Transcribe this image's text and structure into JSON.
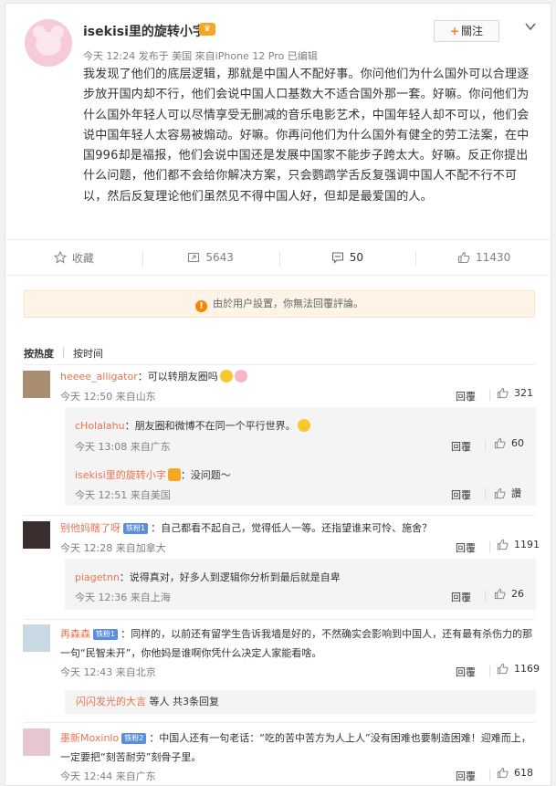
{
  "post": {
    "author": "isekisi里的旋转小字",
    "meta": "今天 12:24 发布于 美国 來自iPhone 12 Pro  已编辑",
    "follow_label": "關注",
    "text": "我发现了他们的底层逻辑，那就是中国人不配好事。你问他们为什么国外可以合理逐步放开国内却不行，他们会说中国人口基数大不适合国外那一套。好嘛。你问他们为什么国外年轻人可以尽情享受无删减的音乐电影艺术，中国年轻人却不可以，他们会说中国年轻人太容易被煽动。好嘛。你再问他们为什么国外有健全的劳工法案，在中国996却是福报，他们会说中国还是发展中国家不能步子跨太大。好嘛。反正你提出什么问题，他们都不会给你解决方案，只会鹦鹉学舌反复强调中国人不配不行不可以，然后反复理论他们虽然见不得中国人好，但却是最爱国的人。"
  },
  "actions": {
    "favorite": "收藏",
    "repost": "5643",
    "comment": "50",
    "like": "11430"
  },
  "notice": "由於用户設置，你無法回覆評論。",
  "sort": {
    "hot": "按热度",
    "time": "按时间"
  },
  "comments": [
    {
      "name": "heeee_alligator",
      "text": "：可以转朋友圈吗",
      "time": "今天 12:50 来自山东",
      "reply": "回覆",
      "likes": "321"
    },
    {
      "name": "cHolalahu",
      "text": "：朋友圈和微博不在同一个平行世界。",
      "time": "今天 13:08 来自广东",
      "reply": "回覆",
      "likes": "60"
    },
    {
      "name": "isekisi里的旋转小字",
      "text": "：没问题～",
      "time": "今天 12:51 来自美国",
      "reply": "回覆",
      "likes": "讚"
    },
    {
      "name": "别他妈瞎了呀",
      "badge": "铁粉1",
      "text": "：自己都看不起自己，觉得低人一等。还指望谁来可怜、施舍？",
      "time": "今天 12:28 来自加拿大",
      "reply": "回覆",
      "likes": "1191"
    },
    {
      "name": "piagetnn",
      "text": "：说得真对，好多人到逻辑你分析到最后就是自卑",
      "time": "今天 12:36 来自上海",
      "reply": "回覆",
      "likes": "26"
    },
    {
      "name": "再森森",
      "badge": "铁粉1",
      "text": "：同样的，以前还有留学生告诉我墙是好的，不然确实会影响到中国人，还有最有杀伤力的那一句“民智未开”，你他妈是谁啊你凭什么决定人家能看啥。",
      "time": "今天 12:43 来自北京",
      "reply": "回覆",
      "likes": "1169"
    },
    {
      "name": "墨新Moxinlo",
      "badge": "铁粉2",
      "text": "：中国人还有一句老话：“吃的苦中苦方为人上人”没有困难也要制造困难！迎难而上，一定要把“刻苦耐劳”刻骨子里。",
      "time": "今天 12:44 来自广东",
      "reply": "回覆",
      "likes": "618"
    }
  ],
  "more_replies": {
    "name": "闪闪发光的大言",
    "rest": " 等人 共3条回复"
  },
  "colors": {
    "accent": "#ff8200",
    "name": "#eb7350",
    "fan_badge": "#5b8ddf"
  }
}
